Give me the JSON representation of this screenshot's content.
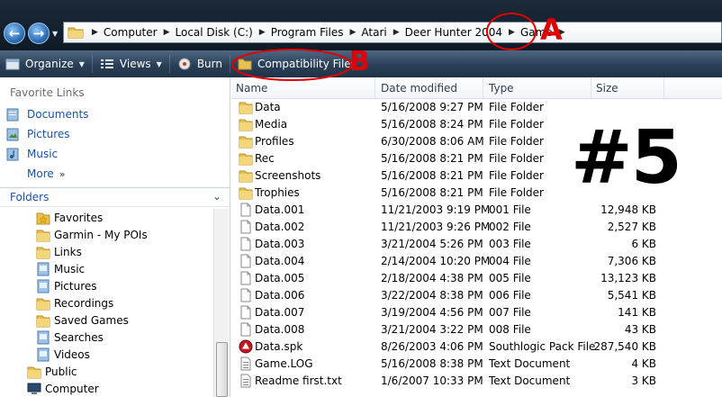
{
  "address": {
    "crumbs": [
      "Computer",
      "Local Disk (C:)",
      "Program Files",
      "Atari",
      "Deer Hunter 2004",
      "Game"
    ]
  },
  "toolbar": {
    "organize": "Organize",
    "views": "Views",
    "burn": "Burn",
    "compat": "Compatibility Files"
  },
  "nav": {
    "favorite_links_header": "Favorite Links",
    "favorites": [
      "Documents",
      "Pictures",
      "Music"
    ],
    "more": "More",
    "folders_header": "Folders",
    "tree": [
      "Favorites",
      "Garmin - My POIs",
      "Links",
      "Music",
      "Pictures",
      "Recordings",
      "Saved Games",
      "Searches",
      "Videos",
      "Public",
      "Computer"
    ]
  },
  "columns": {
    "name": "Name",
    "date": "Date modified",
    "type": "Type",
    "size": "Size"
  },
  "files": [
    {
      "name": "Data",
      "date": "5/16/2008 9:27 PM",
      "type": "File Folder",
      "size": "",
      "icon": "folder-icon"
    },
    {
      "name": "Media",
      "date": "5/16/2008 8:24 PM",
      "type": "File Folder",
      "size": "",
      "icon": "folder-icon"
    },
    {
      "name": "Profiles",
      "date": "6/30/2008 8:06 AM",
      "type": "File Folder",
      "size": "",
      "icon": "folder-icon"
    },
    {
      "name": "Rec",
      "date": "5/16/2008 8:21 PM",
      "type": "File Folder",
      "size": "",
      "icon": "folder-icon"
    },
    {
      "name": "Screenshots",
      "date": "5/16/2008 8:21 PM",
      "type": "File Folder",
      "size": "",
      "icon": "folder-icon"
    },
    {
      "name": "Trophies",
      "date": "5/16/2008 8:21 PM",
      "type": "File Folder",
      "size": "",
      "icon": "folder-icon"
    },
    {
      "name": "Data.001",
      "date": "11/21/2003 9:19 PM",
      "type": "001 File",
      "size": "12,948 KB",
      "icon": "file-icon"
    },
    {
      "name": "Data.002",
      "date": "11/21/2003 9:26 PM",
      "type": "002 File",
      "size": "2,527 KB",
      "icon": "file-icon"
    },
    {
      "name": "Data.003",
      "date": "3/21/2004 5:26 PM",
      "type": "003 File",
      "size": "6 KB",
      "icon": "file-icon"
    },
    {
      "name": "Data.004",
      "date": "2/14/2004 10:20 PM",
      "type": "004 File",
      "size": "7,306 KB",
      "icon": "file-icon"
    },
    {
      "name": "Data.005",
      "date": "2/18/2004 4:38 PM",
      "type": "005 File",
      "size": "13,123 KB",
      "icon": "file-icon"
    },
    {
      "name": "Data.006",
      "date": "3/22/2004 8:38 PM",
      "type": "006 File",
      "size": "5,541 KB",
      "icon": "file-icon"
    },
    {
      "name": "Data.007",
      "date": "3/19/2004 4:56 PM",
      "type": "007 File",
      "size": "141 KB",
      "icon": "file-icon"
    },
    {
      "name": "Data.008",
      "date": "3/21/2004 3:22 PM",
      "type": "008 File",
      "size": "43 KB",
      "icon": "file-icon"
    },
    {
      "name": "Data.spk",
      "date": "8/26/2003 4:06 PM",
      "type": "Southlogic Pack File",
      "size": "287,540 KB",
      "icon": "spk-icon"
    },
    {
      "name": "Game.LOG",
      "date": "5/16/2008 8:38 PM",
      "type": "Text Document",
      "size": "4 KB",
      "icon": "text-file-icon"
    },
    {
      "name": "Readme first.txt",
      "date": "1/6/2007 10:33 PM",
      "type": "Text Document",
      "size": "3 KB",
      "icon": "text-file-icon"
    }
  ],
  "annotations": {
    "a": "A",
    "b": "B",
    "number": "#5",
    "color": "#e00000"
  }
}
